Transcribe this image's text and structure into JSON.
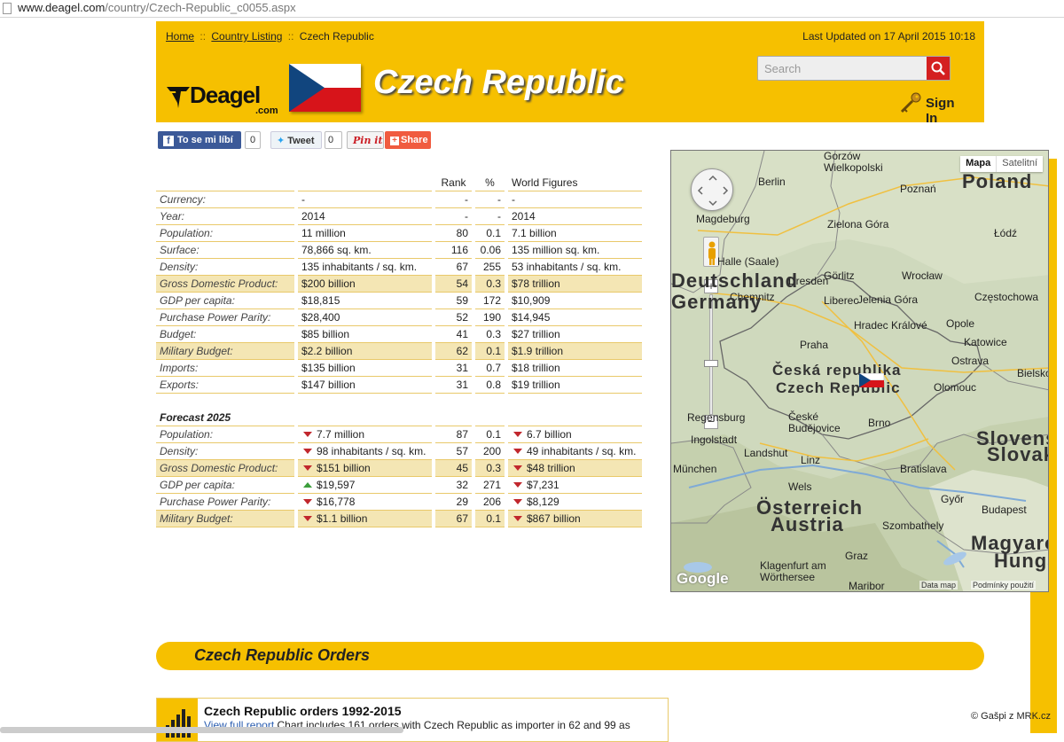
{
  "browser": {
    "url_host": "www.deagel.com",
    "url_path": "/country/Czech-Republic_c0055.aspx"
  },
  "breadcrumb": {
    "home": "Home",
    "sep": "::",
    "listing": "Country Listing",
    "current": "Czech Republic"
  },
  "last_updated": "Last Updated on 17 April 2015 10:18",
  "logo": {
    "name": "Deagel",
    "suffix": ".com"
  },
  "page_title": "Czech Republic",
  "search": {
    "placeholder": "Search"
  },
  "signin": {
    "label": "Sign In"
  },
  "social": {
    "fb_label": "To se mi líbí",
    "fb_count": "0",
    "tweet_label": "Tweet",
    "tweet_count": "0",
    "pin_label": "Pin it",
    "share_label": "Share"
  },
  "stats": {
    "headers": {
      "rank": "Rank",
      "pct": "%",
      "world": "World Figures"
    },
    "rows": [
      {
        "label": "Currency:",
        "value": "-",
        "rank": "-",
        "pct": "-",
        "world": "-",
        "hl": false
      },
      {
        "label": "Year:",
        "value": "2014",
        "rank": "-",
        "pct": "-",
        "world": "2014",
        "hl": false
      },
      {
        "label": "Population:",
        "value": "11 million",
        "rank": "80",
        "pct": "0.1",
        "world": "7.1 billion",
        "hl": false
      },
      {
        "label": "Surface:",
        "value": "78,866 sq. km.",
        "rank": "116",
        "pct": "0.06",
        "world": "135 million sq. km.",
        "hl": false
      },
      {
        "label": "Density:",
        "value": "135 inhabitants / sq. km.",
        "rank": "67",
        "pct": "255",
        "world": "53 inhabitants / sq. km.",
        "hl": false
      },
      {
        "label": "Gross Domestic Product:",
        "value": "$200 billion",
        "rank": "54",
        "pct": "0.3",
        "world": "$78 trillion",
        "hl": true
      },
      {
        "label": "GDP per capita:",
        "value": "$18,815",
        "rank": "59",
        "pct": "172",
        "world": "$10,909",
        "hl": false
      },
      {
        "label": "Purchase Power Parity:",
        "value": "$28,400",
        "rank": "52",
        "pct": "190",
        "world": "$14,945",
        "hl": false
      },
      {
        "label": "Budget:",
        "value": "$85 billion",
        "rank": "41",
        "pct": "0.3",
        "world": "$27 trillion",
        "hl": false
      },
      {
        "label": "Military Budget:",
        "value": "$2.2 billion",
        "rank": "62",
        "pct": "0.1",
        "world": "$1.9 trillion",
        "hl": true
      },
      {
        "label": "Imports:",
        "value": "$135 billion",
        "rank": "31",
        "pct": "0.7",
        "world": "$18 trillion",
        "hl": false
      },
      {
        "label": "Exports:",
        "value": "$147 billion",
        "rank": "31",
        "pct": "0.8",
        "world": "$19 trillion",
        "hl": false
      }
    ],
    "forecast_title": "Forecast 2025",
    "forecast": [
      {
        "label": "Population:",
        "value": "7.7 million",
        "trend": "down",
        "rank": "87",
        "pct": "0.1",
        "world": "6.7 billion",
        "wtrend": "down",
        "hl": false
      },
      {
        "label": "Density:",
        "value": "98 inhabitants / sq. km.",
        "trend": "down",
        "rank": "57",
        "pct": "200",
        "world": "49 inhabitants / sq. km.",
        "wtrend": "down",
        "hl": false
      },
      {
        "label": "Gross Domestic Product:",
        "value": "$151 billion",
        "trend": "down",
        "rank": "45",
        "pct": "0.3",
        "world": "$48 trillion",
        "wtrend": "down",
        "hl": true
      },
      {
        "label": "GDP per capita:",
        "value": "$19,597",
        "trend": "up",
        "rank": "32",
        "pct": "271",
        "world": "$7,231",
        "wtrend": "down",
        "hl": false
      },
      {
        "label": "Purchase Power Parity:",
        "value": "$16,778",
        "trend": "down",
        "rank": "29",
        "pct": "206",
        "world": "$8,129",
        "wtrend": "down",
        "hl": false
      },
      {
        "label": "Military Budget:",
        "value": "$1.1 billion",
        "trend": "down",
        "rank": "67",
        "pct": "0.1",
        "world": "$867 billion",
        "wtrend": "down",
        "hl": true
      }
    ]
  },
  "map": {
    "type_map": "Mapa",
    "type_sat": "Satelitní",
    "country_line1": "Česká republika",
    "country_line2": "Czech Republic",
    "cities": [
      "Gorzów Wielkopolski",
      "Poznań",
      "Berlin",
      "Poland",
      "Magdeburg",
      "Zielona Góra",
      "Łódź",
      "Halle (Saale)",
      "Wrocław",
      "Dresden",
      "Görlitz",
      "Częstochowa",
      "Chemnitz",
      "Liberec",
      "Jelenia Góra",
      "Opole",
      "Hradec Králové",
      "Katowice",
      "Praha",
      "Ostrava",
      "Bielsko",
      "Olomouc",
      "Regensburg",
      "České Budějovice",
      "Brno",
      "Ingolstadt",
      "Landshut",
      "Slovensko",
      "Slovakia",
      "München",
      "Linz",
      "Bratislava",
      "Wels",
      "Österreich",
      "Austria",
      "Győr",
      "Budapest",
      "Szombathely",
      "Graz",
      "Magyarország",
      "Hungary",
      "Klagenfurt am Wörthersee",
      "Maribor",
      "Deutschland",
      "Germany"
    ],
    "footer_data": "Data map",
    "footer_terms": "Podmínky použití",
    "google": "Google"
  },
  "orders": {
    "section_title": "Czech Republic Orders",
    "item_title": "Czech Republic orders 1992-2015",
    "item_link": "View full report",
    "item_desc": "Chart includes 161 orders with Czech Republic as importer in 62 and 99 as"
  },
  "copyright": "© Gašpi z MRK.cz",
  "colors": {
    "brand_yellow": "#f6c000",
    "highlight_row": "#f4e6b4",
    "down_arrow": "#c1272d",
    "up_arrow": "#3b9e3b"
  }
}
